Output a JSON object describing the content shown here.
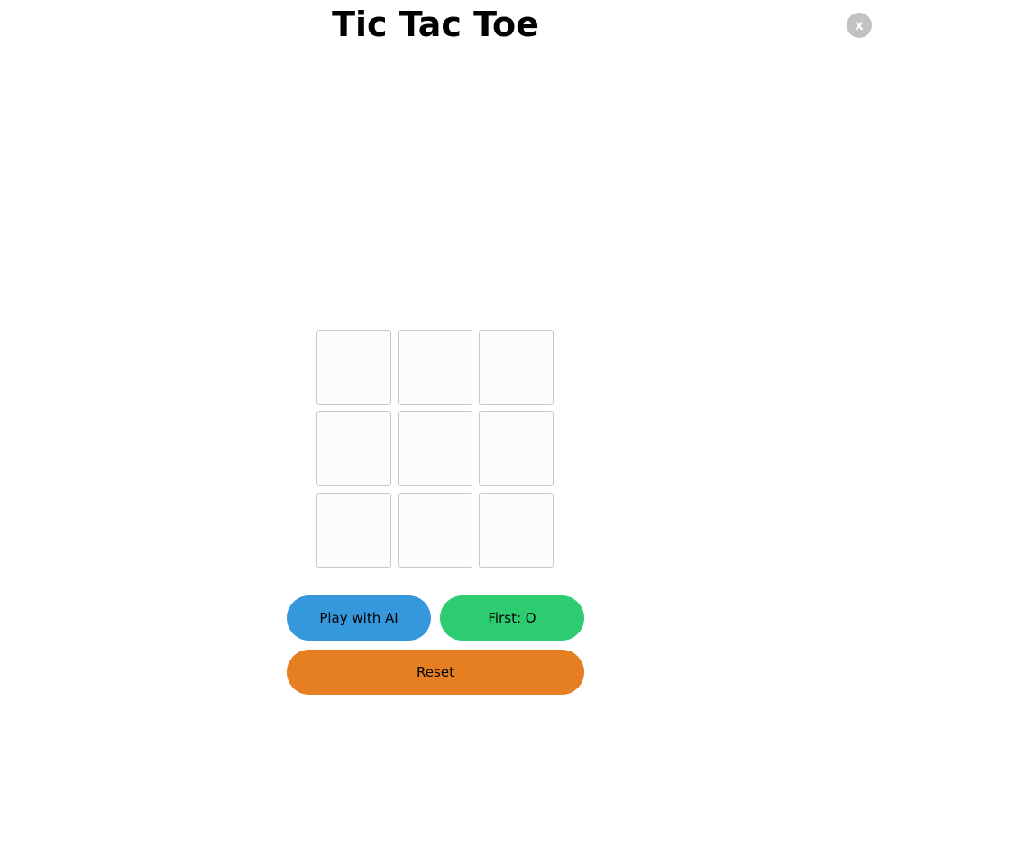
{
  "header": {
    "title": "Tic Tac Toe",
    "close_label": "x"
  },
  "board": {
    "cells": [
      "",
      "",
      "",
      "",
      "",
      "",
      "",
      "",
      ""
    ]
  },
  "controls": {
    "play_ai_label": "Play with AI",
    "first_label": "First: O",
    "reset_label": "Reset"
  },
  "colors": {
    "play_ai": "#3498db",
    "first": "#2ecc71",
    "reset": "#e67e22",
    "close": "#c2c2c2",
    "cell_bg": "#fcfcfc",
    "cell_border": "#c8c8c8"
  }
}
